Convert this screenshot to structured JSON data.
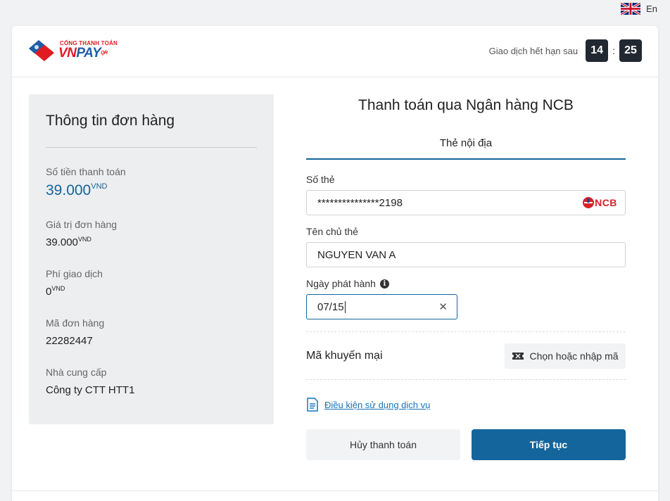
{
  "language": {
    "label": "En",
    "icon": "uk-flag-icon"
  },
  "header": {
    "logo": {
      "small_text": "CỔNG THANH TOÁN",
      "brand_vn": "VN",
      "brand_pay": "PAY",
      "brand_qr": "QR"
    },
    "timer": {
      "label": "Giao dịch hết hạn sau",
      "minutes": "14",
      "separator": ":",
      "seconds": "25"
    }
  },
  "order": {
    "title": "Thông tin đơn hàng",
    "amount": {
      "label": "Số tiền thanh toán",
      "value": "39.000",
      "unit": "VND"
    },
    "order_value": {
      "label": "Giá trị đơn hàng",
      "value": "39.000",
      "unit": "VND"
    },
    "fee": {
      "label": "Phí giao dịch",
      "value": "0",
      "unit": "VND"
    },
    "order_id": {
      "label": "Mã đơn hàng",
      "value": "22282447"
    },
    "provider": {
      "label": "Nhà cung cấp",
      "value": "Công ty CTT HTT1"
    }
  },
  "payment": {
    "title": "Thanh toán qua Ngân hàng NCB",
    "tab": "Thẻ nội địa",
    "card_number": {
      "label": "Số thẻ",
      "value": "***************2198",
      "bank_logo": "NCB"
    },
    "card_holder": {
      "label": "Tên chủ thẻ",
      "value": "NGUYEN VAN A"
    },
    "issue_date": {
      "label": "Ngày phát hành",
      "value": "07/15"
    },
    "promo": {
      "label": "Mã khuyến mại",
      "button": "Chọn hoặc nhập mã"
    },
    "terms": "Điều kiện sử dụng dịch vụ",
    "cancel_button": "Hủy thanh toán",
    "next_button": "Tiếp tục"
  }
}
